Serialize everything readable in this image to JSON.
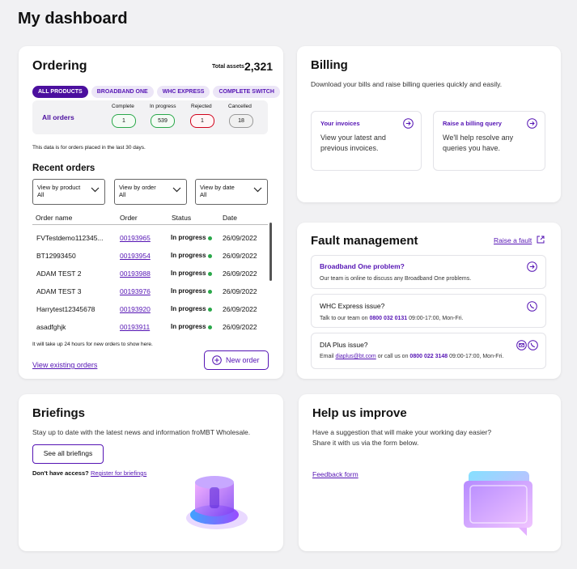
{
  "page": {
    "title": "My dashboard"
  },
  "ordering": {
    "title": "Ordering",
    "total_label": "Total assets",
    "total_value": "2,321",
    "tabs": [
      "ALL PRODUCTS",
      "BROADBAND ONE",
      "WHC EXPRESS",
      "COMPLETE SWITCH"
    ],
    "summary": {
      "label": "All orders",
      "headers": [
        "Complete",
        "In progress",
        "Rejected",
        "Cancelled"
      ],
      "values": [
        "1",
        "539",
        "1",
        "18"
      ]
    },
    "note": "This data is for orders placed in the last 30 days.",
    "recent_title": "Recent orders",
    "filters": [
      {
        "label": "View by product",
        "value": "All"
      },
      {
        "label": "View by order",
        "value": "All"
      },
      {
        "label": "View by date",
        "value": "All"
      }
    ],
    "columns": [
      "Order name",
      "Order",
      "Status",
      "Date"
    ],
    "rows": [
      {
        "name": "FVTestdemo112345...",
        "order": "00193965",
        "status": "In progress",
        "date": "26/09/2022"
      },
      {
        "name": "BT12993450",
        "order": "00193954",
        "status": "In progress",
        "date": "26/09/2022"
      },
      {
        "name": "ADAM TEST 2",
        "order": "00193988",
        "status": "In progress",
        "date": "26/09/2022"
      },
      {
        "name": "ADAM TEST 3",
        "order": "00193976",
        "status": "In progress",
        "date": "26/09/2022"
      },
      {
        "name": "Harrytest12345678",
        "order": "00193920",
        "status": "In progress",
        "date": "26/09/2022"
      },
      {
        "name": "asadfghjk",
        "order": "00193911",
        "status": "In progress",
        "date": "26/09/2022"
      }
    ],
    "footer_note": "It will take up 24 hours for new orders to show here.",
    "view_link": "View existing orders",
    "new_order": "New order"
  },
  "billing": {
    "title": "Billing",
    "desc": "Download your bills and raise billing queries quickly and easily.",
    "invoices_title": "Your invoices",
    "invoices_desc": "View your latest and previous invoices.",
    "query_title": "Raise a billing query",
    "query_desc": "We'll help resolve any queries you have."
  },
  "fault": {
    "title": "Fault management",
    "raise": "Raise a fault",
    "bb_title": "Broadband One problem?",
    "bb_desc": "Our team is online to discuss any Broadband One problems.",
    "whc_title": "WHC Express issue?",
    "whc_pre": "Talk to our team on",
    "whc_phone": "0800 032 0131",
    "whc_hours": "09:00-17:00, Mon-Fri.",
    "dia_title": "DIA Plus issue?",
    "dia_pre": "Email",
    "dia_email": "diaplus@bt.com",
    "dia_mid": "or call us on",
    "dia_phone": "0800 022 3148",
    "dia_hours": "09:00-17:00, Mon-Fri."
  },
  "briefings": {
    "title": "Briefings",
    "desc": "Stay up to date with the latest news and information froMBT Wholesale.",
    "button": "See all briefings",
    "access": "Don't have access?",
    "register": "Register for briefings"
  },
  "help": {
    "title": "Help us improve",
    "desc1": "Have a suggestion that will make your working day easier?",
    "desc2": "Share it with us via the form below.",
    "link": "Feedback form"
  },
  "colors": {
    "accent": "#5514b4",
    "green": "#2aa84a",
    "red": "#d0021b"
  }
}
